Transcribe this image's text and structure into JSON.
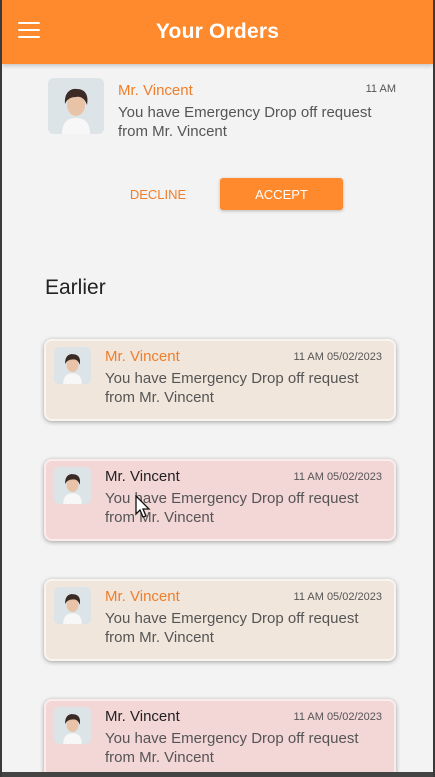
{
  "appbar": {
    "title": "Your Orders",
    "menu_icon": "hamburger-menu-icon",
    "color": "#ff8a2e"
  },
  "latest": {
    "name": "Mr. Vincent",
    "time": "11 AM",
    "message": "You have Emergency Drop off request from Mr. Vincent",
    "decline_label": "DECLINE",
    "accept_label": "ACCEPT"
  },
  "earlier": {
    "heading": "Earlier",
    "items": [
      {
        "name": "Mr. Vincent",
        "time": "11 AM 05/02/2023",
        "message": "You have Emergency Drop off request from Mr. Vincent",
        "style": "beige"
      },
      {
        "name": "Mr. Vincent",
        "time": "11 AM 05/02/2023",
        "message": "You have Emergency Drop off request from Mr. Vincent",
        "style": "pink"
      },
      {
        "name": "Mr. Vincent",
        "time": "11 AM 05/02/2023",
        "message": "You have Emergency Drop off request from Mr. Vincent",
        "style": "beige"
      },
      {
        "name": "Mr. Vincent",
        "time": "11 AM 05/02/2023",
        "message": "You have Emergency Drop off request from Mr. Vincent",
        "style": "pink"
      }
    ]
  },
  "colors": {
    "accent": "#ff8a2e",
    "accent_text": "#ef7e2a",
    "beige_card": "#f1e6dc",
    "pink_card": "#f3d6d6"
  }
}
